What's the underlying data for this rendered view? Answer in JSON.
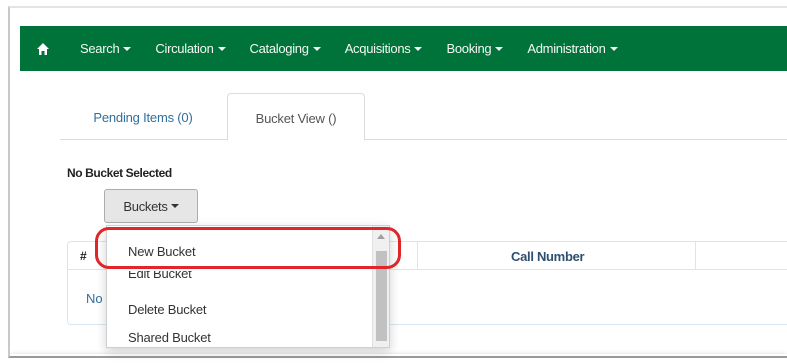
{
  "navbar": {
    "home_icon": "home-icon",
    "items": [
      {
        "label": "Search"
      },
      {
        "label": "Circulation"
      },
      {
        "label": "Cataloging"
      },
      {
        "label": "Acquisitions"
      },
      {
        "label": "Booking"
      },
      {
        "label": "Administration"
      }
    ],
    "color": "#00733a"
  },
  "tabs": [
    {
      "label": "Pending Items (0)",
      "active": false
    },
    {
      "label": "Bucket View ()",
      "active": true
    }
  ],
  "status": {
    "text": "No Bucket Selected"
  },
  "buckets_button": {
    "label": "Buckets"
  },
  "grid": {
    "columns": [
      "#",
      "Call Number"
    ],
    "empty_text": "No"
  },
  "dropdown": {
    "items": [
      "New Bucket",
      "Edit Bucket",
      "Delete Bucket",
      "Shared Bucket"
    ],
    "highlighted": "New Bucket",
    "highlight_color": "#e0262a"
  }
}
